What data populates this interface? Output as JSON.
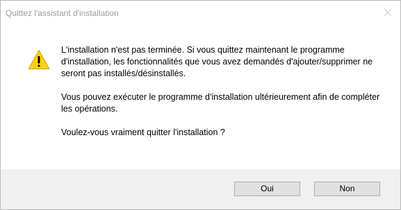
{
  "window": {
    "title": "Quittez l'assistant d'installation"
  },
  "icons": {
    "close": "close-icon",
    "warning": "warning-icon"
  },
  "message": {
    "paragraph1": "L'installation n'est pas terminée. Si vous quittez maintenant le programme d'installation, les fonctionnalités que vous avez demandés d'ajouter/supprimer ne seront pas installés/désinstallés.",
    "paragraph2": "Vous pouvez exécuter le programme d'installation ultérieurement afin de compléter les opérations.",
    "question": "Voulez-vous vraiment quitter l'installation ?"
  },
  "buttons": {
    "yes_label": "Oui",
    "no_label": "Non"
  },
  "colors": {
    "warning_fill": "#fcd116",
    "footer_bg": "#f0f0f0",
    "button_bg": "#e1e1e1"
  }
}
